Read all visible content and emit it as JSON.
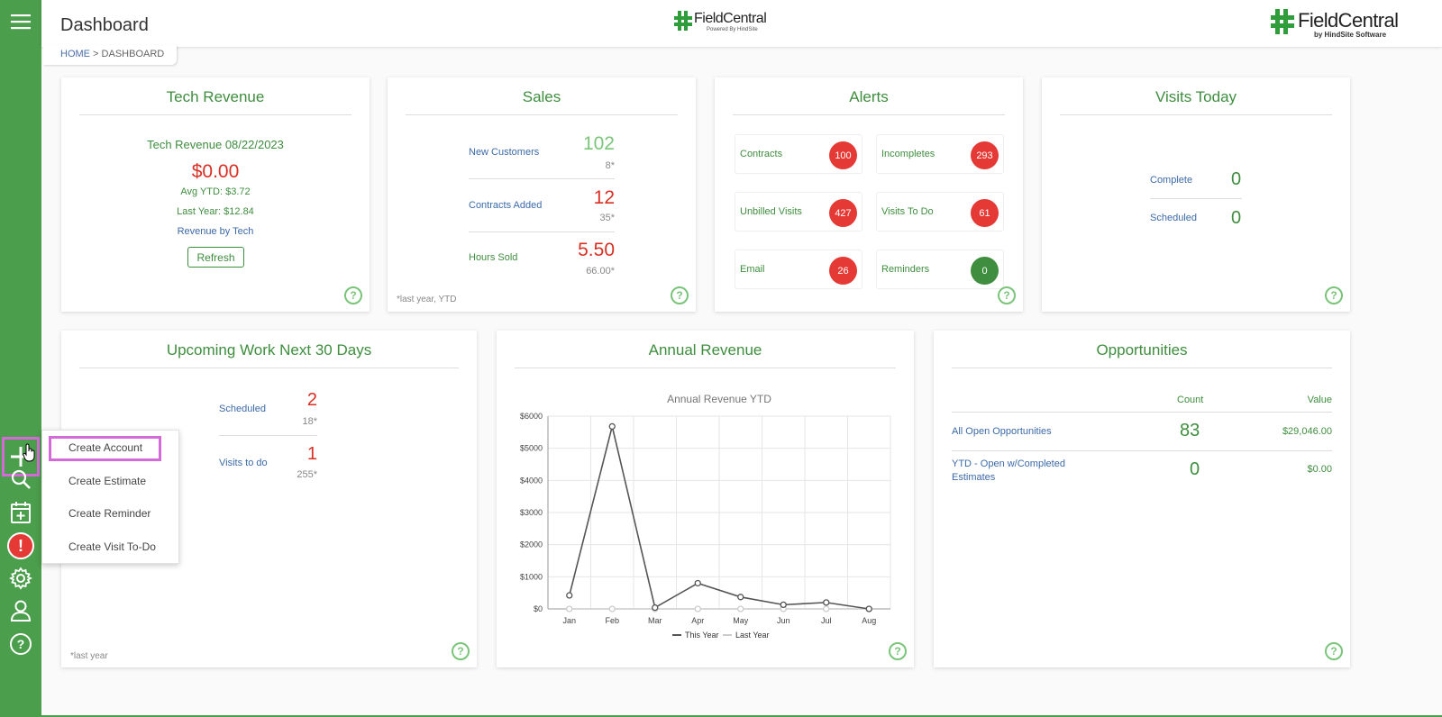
{
  "header": {
    "page_title": "Dashboard",
    "logo_center_text": "FieldCentral",
    "logo_center_sub": "Powered By HindSite",
    "logo_right_text": "FieldCentral",
    "logo_right_sub": "by HindSite Software"
  },
  "breadcrumb": {
    "home": "HOME",
    "sep": " > ",
    "current": "DASHBOARD"
  },
  "sidebar": {
    "icons": [
      "menu-icon",
      "plus-icon",
      "search-icon",
      "calendar-add-icon",
      "alert-icon",
      "gear-icon",
      "user-icon",
      "help-circle-icon"
    ],
    "alert_color": "#e53935"
  },
  "dropdown": {
    "items": [
      "Create Account",
      "Create Estimate",
      "Create Reminder",
      "Create Visit To-Do"
    ]
  },
  "tech_revenue": {
    "title": "Tech Revenue",
    "subtitle": "Tech Revenue 08/22/2023",
    "amount": "$0.00",
    "avg_ytd": "Avg YTD: $3.72",
    "last_year": "Last Year: $12.84",
    "link": "Revenue by Tech",
    "refresh": "Refresh"
  },
  "sales": {
    "title": "Sales",
    "rows": [
      {
        "label": "New Customers",
        "value": "102",
        "sub": "8*"
      },
      {
        "label": "Contracts Added",
        "value": "12",
        "sub": "35*"
      },
      {
        "label": "Hours Sold",
        "value": "5.50",
        "sub": "66.00*"
      }
    ],
    "footnote": "*last year, YTD"
  },
  "alerts": {
    "title": "Alerts",
    "items": [
      {
        "label": "Contracts",
        "count": "100",
        "color": "#e53935"
      },
      {
        "label": "Incompletes",
        "count": "293",
        "color": "#e53935"
      },
      {
        "label": "Unbilled Visits",
        "count": "427",
        "color": "#e53935"
      },
      {
        "label": "Visits To Do",
        "count": "61",
        "color": "#e53935"
      },
      {
        "label": "Email",
        "count": "26",
        "color": "#e53935"
      },
      {
        "label": "Reminders",
        "count": "0",
        "color": "#3f8d3f"
      }
    ]
  },
  "visits_today": {
    "title": "Visits Today",
    "rows": [
      {
        "label": "Complete",
        "value": "0"
      },
      {
        "label": "Scheduled",
        "value": "0"
      }
    ]
  },
  "upcoming": {
    "title": "Upcoming Work Next 30 Days",
    "rows": [
      {
        "label": "Scheduled",
        "value": "2",
        "sub": "18*"
      },
      {
        "label": "Visits to do",
        "value": "1",
        "sub": "255*"
      }
    ],
    "footnote": "*last year"
  },
  "annual_revenue": {
    "title": "Annual Revenue"
  },
  "opportunities": {
    "title": "Opportunities",
    "col_count": "Count",
    "col_value": "Value",
    "rows": [
      {
        "label": "All Open Opportunities",
        "count": "83",
        "value": "$29,046.00"
      },
      {
        "label": "YTD - Open w/Completed Estimates",
        "count": "0",
        "value": "$0.00"
      }
    ]
  },
  "help_label": "?",
  "chart_data": {
    "type": "line",
    "title": "Annual Revenue YTD",
    "categories": [
      "Jan",
      "Feb",
      "Mar",
      "Apr",
      "May",
      "Jun",
      "Jul",
      "Aug"
    ],
    "series": [
      {
        "name": "This Year",
        "values": [
          420,
          5680,
          40,
          800,
          370,
          130,
          200,
          0
        ],
        "color": "#555555"
      },
      {
        "name": "Last Year",
        "values": [
          0,
          0,
          0,
          0,
          0,
          0,
          0,
          0
        ],
        "color": "#cccccc"
      }
    ],
    "yticks": [
      "$0",
      "$1000",
      "$2000",
      "$3000",
      "$4000",
      "$5000",
      "$6000"
    ],
    "ylim": [
      0,
      6000
    ],
    "grid": true,
    "legend": "bottom"
  }
}
